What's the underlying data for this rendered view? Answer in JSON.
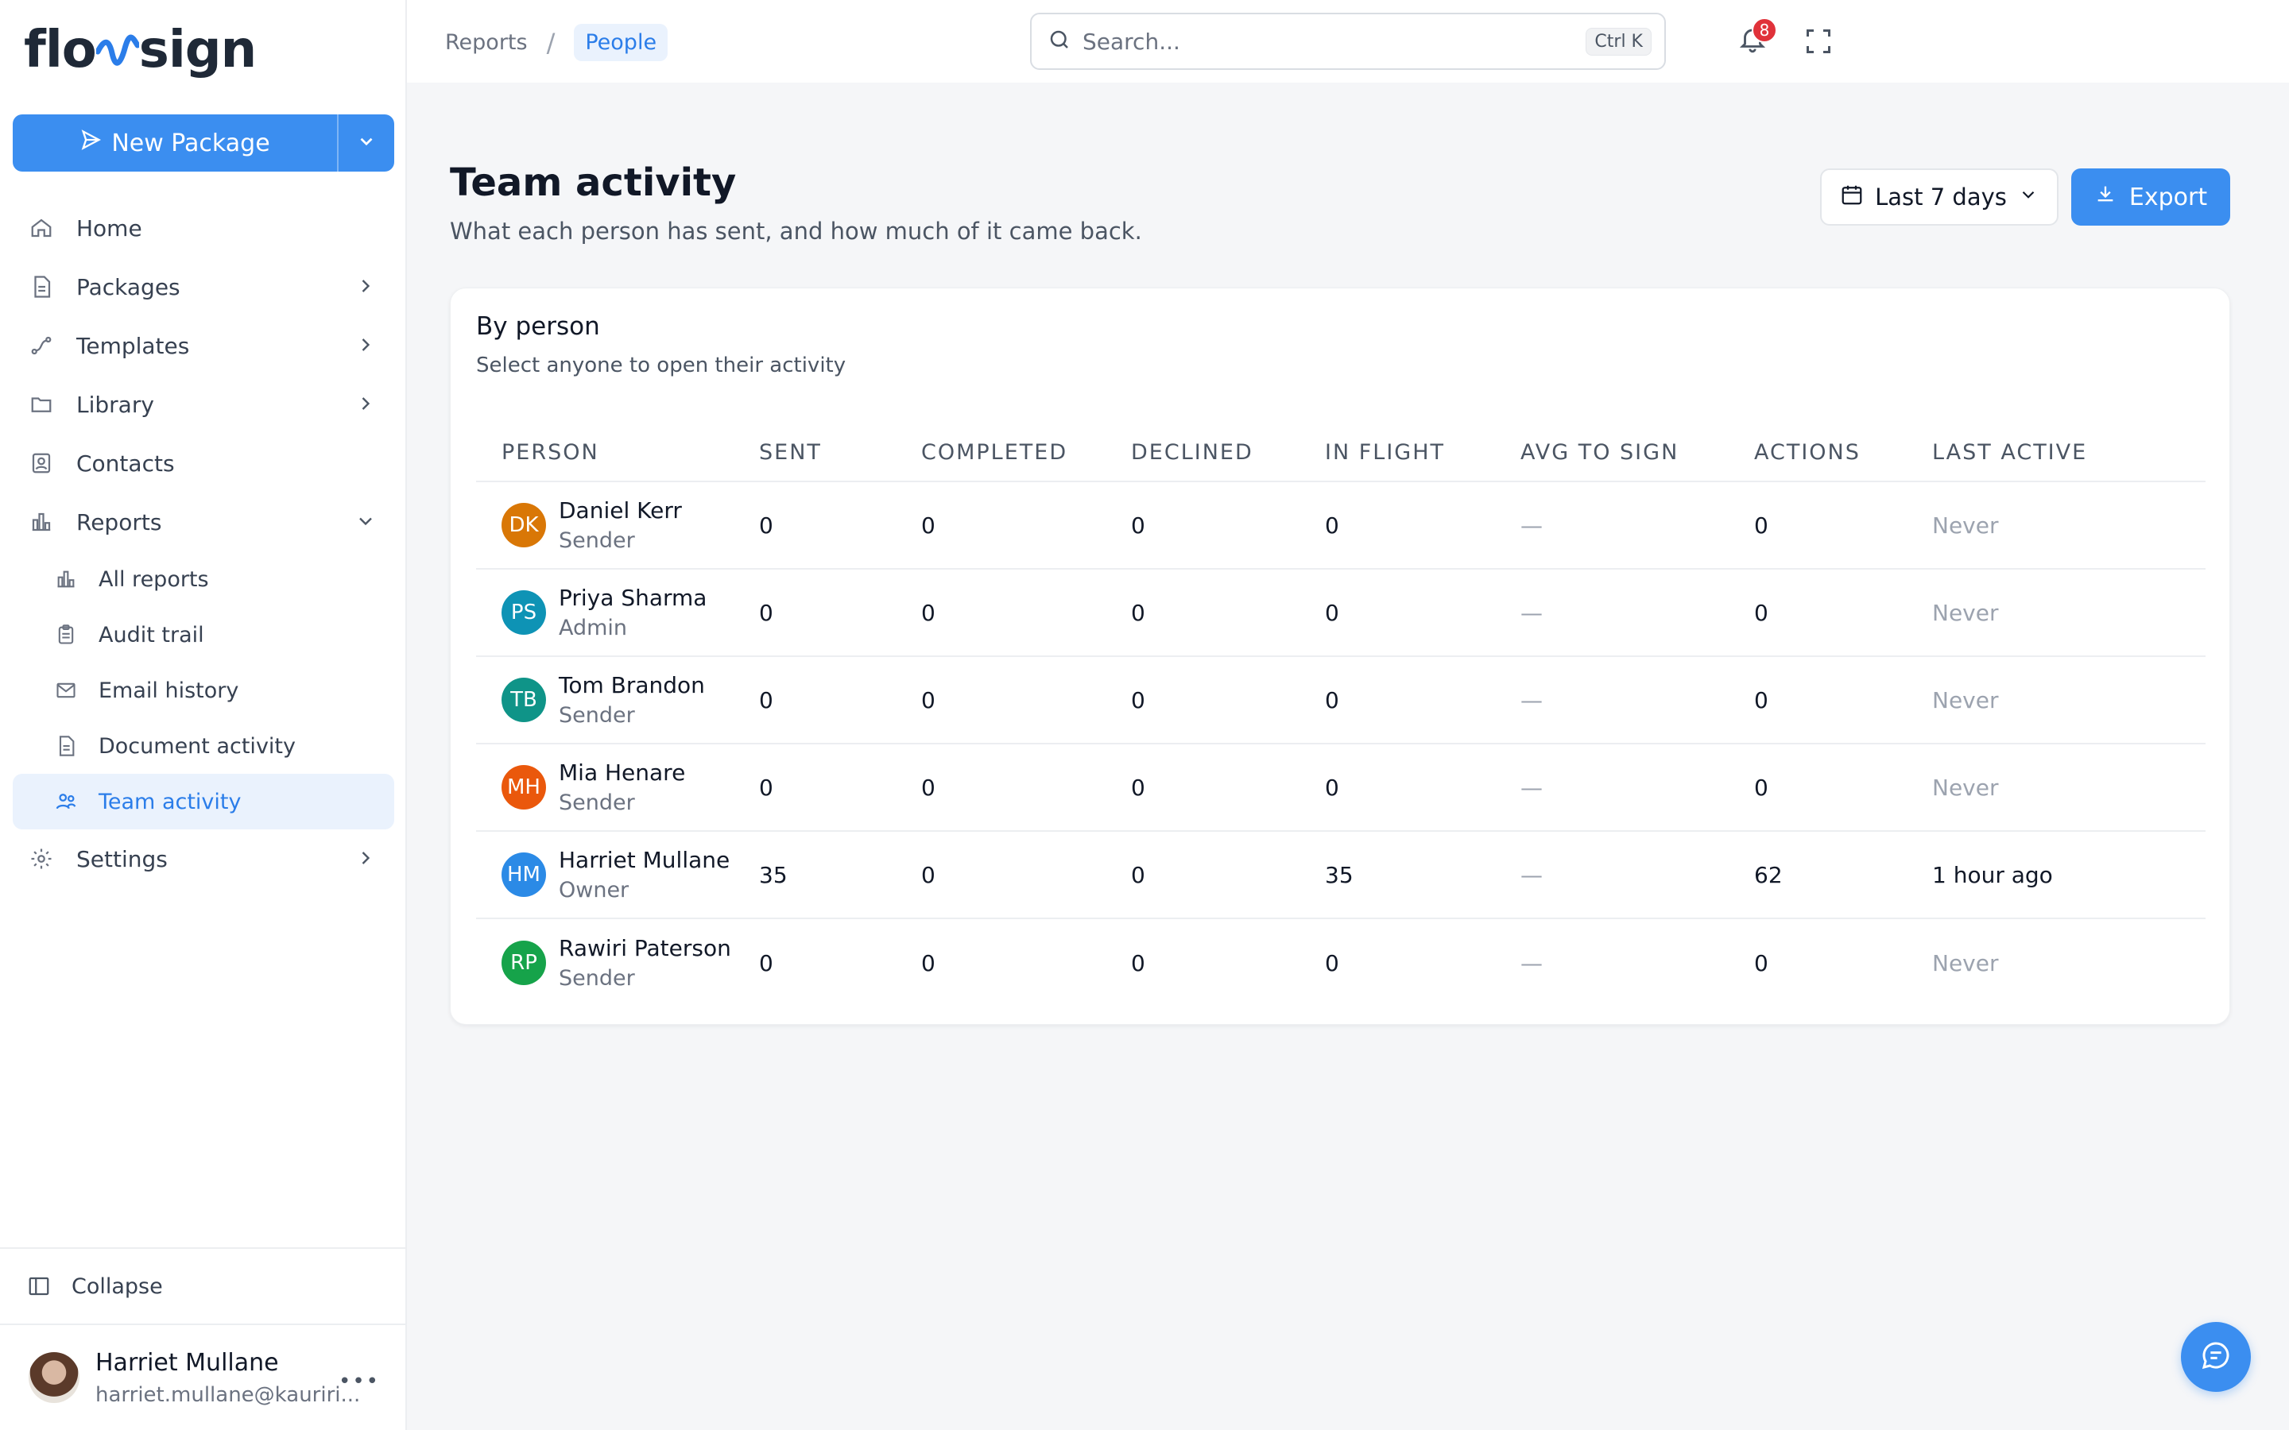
{
  "brand": {
    "logo_prefix": "flo",
    "logo_suffix": "sign",
    "accent": "#3b8ef0"
  },
  "sidebar": {
    "new_package_label": "New Package",
    "items": [
      {
        "label": "Home",
        "icon": "home-icon"
      },
      {
        "label": "Packages",
        "icon": "document-icon"
      },
      {
        "label": "Templates",
        "icon": "route-icon"
      },
      {
        "label": "Library",
        "icon": "folder-icon"
      },
      {
        "label": "Contacts",
        "icon": "contact-icon"
      },
      {
        "label": "Reports",
        "icon": "bar-chart-icon"
      }
    ],
    "report_subitems": [
      {
        "label": "All reports",
        "icon": "bar-chart-icon"
      },
      {
        "label": "Audit trail",
        "icon": "clipboard-icon"
      },
      {
        "label": "Email history",
        "icon": "mail-icon"
      },
      {
        "label": "Document activity",
        "icon": "document-icon"
      },
      {
        "label": "Team activity",
        "icon": "users-icon"
      }
    ],
    "settings_label": "Settings",
    "collapse_label": "Collapse",
    "user": {
      "name": "Harriet Mullane",
      "email": "harriet.mullane@kauriri..."
    }
  },
  "topbar": {
    "breadcrumb": [
      "Reports",
      "People"
    ],
    "search_placeholder": "Search...",
    "search_shortcut": "Ctrl K",
    "notification_count": "8"
  },
  "main": {
    "title": "Team activity",
    "subtitle": "What each person has sent, and how much of it came back.",
    "range_label": "Last 7 days",
    "export_label": "Export"
  },
  "card": {
    "title": "By person",
    "subtitle": "Select anyone to open their activity",
    "columns": [
      "PERSON",
      "SENT",
      "COMPLETED",
      "DECLINED",
      "IN FLIGHT",
      "AVG TO SIGN",
      "ACTIONS",
      "LAST ACTIVE"
    ],
    "rows": [
      {
        "initials": "DK",
        "color": "#d97706",
        "name": "Daniel Kerr",
        "role": "Sender",
        "sent": "0",
        "completed": "0",
        "declined": "0",
        "in_flight": "0",
        "avg": "—",
        "actions": "0",
        "last_active": "Never"
      },
      {
        "initials": "PS",
        "color": "#0e93b5",
        "name": "Priya Sharma",
        "role": "Admin",
        "sent": "0",
        "completed": "0",
        "declined": "0",
        "in_flight": "0",
        "avg": "—",
        "actions": "0",
        "last_active": "Never"
      },
      {
        "initials": "TB",
        "color": "#0f9488",
        "name": "Tom Brandon",
        "role": "Sender",
        "sent": "0",
        "completed": "0",
        "declined": "0",
        "in_flight": "0",
        "avg": "—",
        "actions": "0",
        "last_active": "Never"
      },
      {
        "initials": "MH",
        "color": "#ea580c",
        "name": "Mia Henare",
        "role": "Sender",
        "sent": "0",
        "completed": "0",
        "declined": "0",
        "in_flight": "0",
        "avg": "—",
        "actions": "0",
        "last_active": "Never"
      },
      {
        "initials": "HM",
        "color": "#2b8ae6",
        "name": "Harriet Mullane",
        "role": "Owner",
        "sent": "35",
        "completed": "0",
        "declined": "0",
        "in_flight": "35",
        "avg": "—",
        "actions": "62",
        "last_active": "1 hour ago"
      },
      {
        "initials": "RP",
        "color": "#16a34a",
        "name": "Rawiri Paterson",
        "role": "Sender",
        "sent": "0",
        "completed": "0",
        "declined": "0",
        "in_flight": "0",
        "avg": "—",
        "actions": "0",
        "last_active": "Never"
      }
    ]
  }
}
